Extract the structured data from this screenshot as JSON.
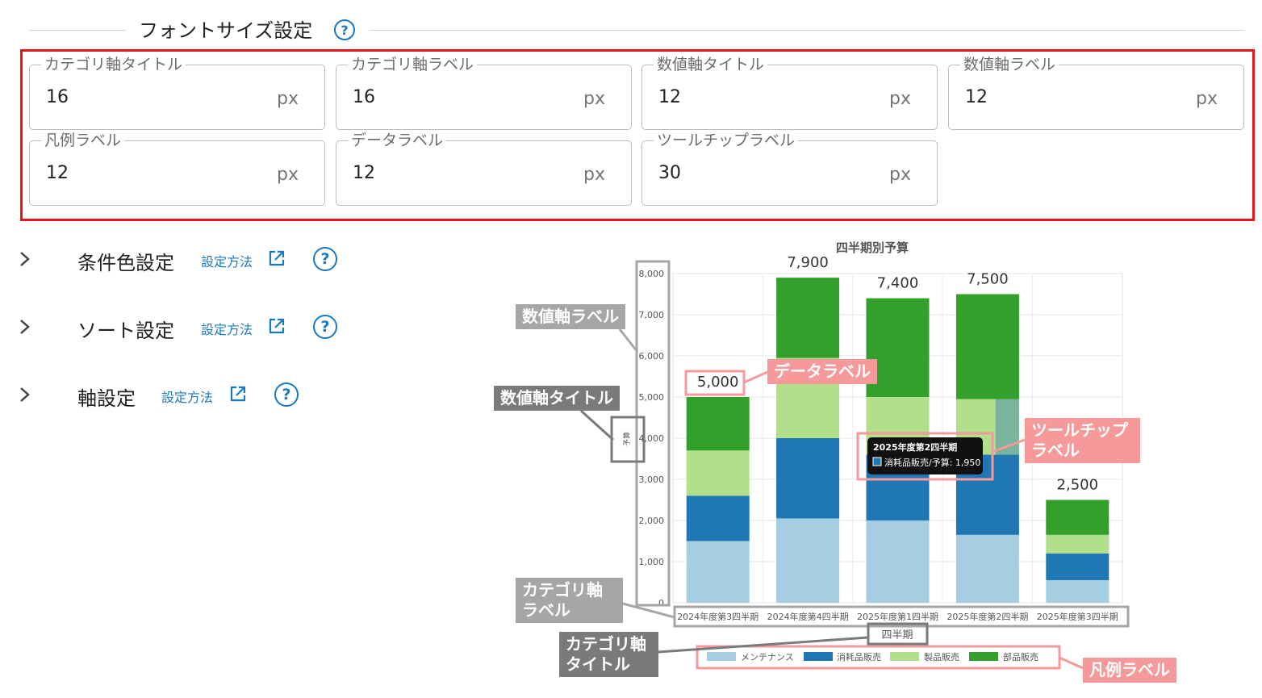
{
  "font_size_section": {
    "title": "フォントサイズ設定",
    "help_icon": "question-circle-icon",
    "fields": [
      {
        "label": "カテゴリ軸タイトル",
        "value": "16",
        "unit": "px"
      },
      {
        "label": "カテゴリ軸ラベル",
        "value": "16",
        "unit": "px"
      },
      {
        "label": "数値軸タイトル",
        "value": "12",
        "unit": "px"
      },
      {
        "label": "数値軸ラベル",
        "value": "12",
        "unit": "px"
      },
      {
        "label": "凡例ラベル",
        "value": "12",
        "unit": "px"
      },
      {
        "label": "データラベル",
        "value": "12",
        "unit": "px"
      },
      {
        "label": "ツールチップラベル",
        "value": "30",
        "unit": "px"
      }
    ]
  },
  "sections": [
    {
      "title": "条件色設定",
      "link": "設定方法"
    },
    {
      "title": "ソート設定",
      "link": "設定方法"
    },
    {
      "title": "軸設定",
      "link": "設定方法"
    }
  ],
  "icons": {
    "expand": "chevron-right-icon",
    "external": "external-link-icon",
    "help": "question-circle-icon"
  },
  "colors": {
    "accent": "#1a78c2",
    "highlight": "#e8141b",
    "annotation_gray": "#a6a6a6",
    "annotation_dark": "#7a7a7a",
    "annotation_pink": "#f6999b"
  },
  "annotations": {
    "value_axis_label": "数値軸ラベル",
    "value_axis_title": "数値軸タイトル",
    "data_label": "データラベル",
    "tooltip_label_1": "ツールチップ",
    "tooltip_label_2": "ラベル",
    "category_axis_label_1": "カテゴリ軸",
    "category_axis_label_2": "ラベル",
    "category_axis_title_1": "カテゴリ軸",
    "category_axis_title_2": "タイトル",
    "legend_label": "凡例ラベル"
  },
  "chart_data": {
    "type": "bar",
    "stacked": true,
    "title": "四半期別予算",
    "xlabel": "四半期",
    "ylabel": "予算",
    "ylim": [
      0,
      8000
    ],
    "yticks": [
      0,
      1000,
      2000,
      3000,
      4000,
      5000,
      6000,
      7000,
      8000
    ],
    "ytick_labels": [
      "0",
      "1,000",
      "2,000",
      "3,000",
      "4,000",
      "5,000",
      "6,000",
      "7,000",
      "8,000"
    ],
    "grid": true,
    "legend_position": "bottom",
    "categories": [
      "2024年度第3四半期",
      "2024年度第4四半期",
      "2025年度第1四半期",
      "2025年度第2四半期",
      "2025年度第3四半期"
    ],
    "series": [
      {
        "name": "メンテナンス",
        "color": "#a6cee3",
        "values": [
          1500,
          2050,
          2000,
          1650,
          550
        ]
      },
      {
        "name": "消耗品販売",
        "color": "#1f78b4",
        "values": [
          1100,
          1950,
          1600,
          1950,
          650
        ]
      },
      {
        "name": "製品販売",
        "color": "#b2df8a",
        "values": [
          1100,
          1950,
          1400,
          1350,
          450
        ]
      },
      {
        "name": "部品販売",
        "color": "#33a02c",
        "values": [
          1300,
          1950,
          2400,
          2550,
          850
        ]
      }
    ],
    "totals": [
      5000,
      7900,
      7400,
      7500,
      2500
    ],
    "total_labels": [
      "5,000",
      "7,900",
      "7,400",
      "7,500",
      "2,500"
    ],
    "tooltip": {
      "title": "2025年度第2四半期",
      "text": "消耗品販売/予算: 1,950"
    }
  }
}
